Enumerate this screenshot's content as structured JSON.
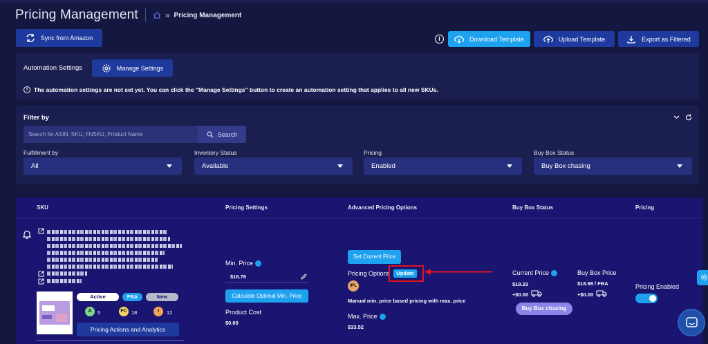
{
  "header": {
    "title": "Pricing Management",
    "breadcrumb_current": "Pricing Management"
  },
  "toolbar": {
    "sync_label": "Sync from Amazon",
    "download_label": "Download Template",
    "upload_label": "Upload Template",
    "export_label": "Export as Filtered",
    "info_icon": "info-icon"
  },
  "automation": {
    "label": "Automation Settings",
    "manage_label": "Manage Settings",
    "note": "The automation settings are not set yet. You can click the \"Manage Settings\" button to create an automation setting that applies to all new SKUs."
  },
  "filter": {
    "title": "Filter by",
    "search_placeholder": "Search for ASIN, SKU, FNSKU, Product Name",
    "search_button": "Search",
    "fields": [
      {
        "label": "Fulfillment by",
        "value": "All"
      },
      {
        "label": "Inventory Status",
        "value": "Available"
      },
      {
        "label": "Pricing",
        "value": "Enabled"
      },
      {
        "label": "Buy Box Status",
        "value": "Buy Box chasing"
      }
    ]
  },
  "table": {
    "columns": [
      "SKU",
      "Pricing Settings",
      "Advanced Pricing Options",
      "Buy Box Status",
      "Pricing"
    ],
    "row": {
      "badges": {
        "active": "Active",
        "fba": "FBA",
        "new": "New"
      },
      "counts": [
        {
          "letter": "A",
          "value": "5",
          "color": "#7fd48a"
        },
        {
          "letter": "FC",
          "value": "18",
          "color": "#f3d36b"
        },
        {
          "letter": "I",
          "value": "12",
          "color": "#f0a55a"
        }
      ],
      "actions_label": "Pricing Actions and Analytics",
      "min_price_label": "Min. Price",
      "min_price_value": "$16.76",
      "calc_label": "Calculate Optimal Min. Price",
      "product_cost_label": "Product Cost",
      "product_cost_value": "$0.00",
      "set_price_label": "Set Current Price",
      "pricing_options_label": "Pricing Options",
      "update_label": "Update",
      "ipl_label": "IPL",
      "strategy_text": "Manual min. price based pricing with max. price",
      "max_price_label": "Max. Price",
      "max_price_value": "$33.52",
      "current_price_label": "Current Price",
      "current_price_value": "$19.23",
      "current_shipping": "+$0.00",
      "buybox_price_label": "Buy Box Price",
      "buybox_price_value": "$18.98 / FBA",
      "buybox_shipping": "+$0.00",
      "buybox_btn": "Buy Box chasing",
      "pricing_enabled_label": "Pricing Enabled",
      "pricing_enabled": true
    }
  },
  "colors": {
    "accent": "#1ea1ee",
    "primary": "#1f3a9e",
    "highlight": "#e0141b"
  }
}
